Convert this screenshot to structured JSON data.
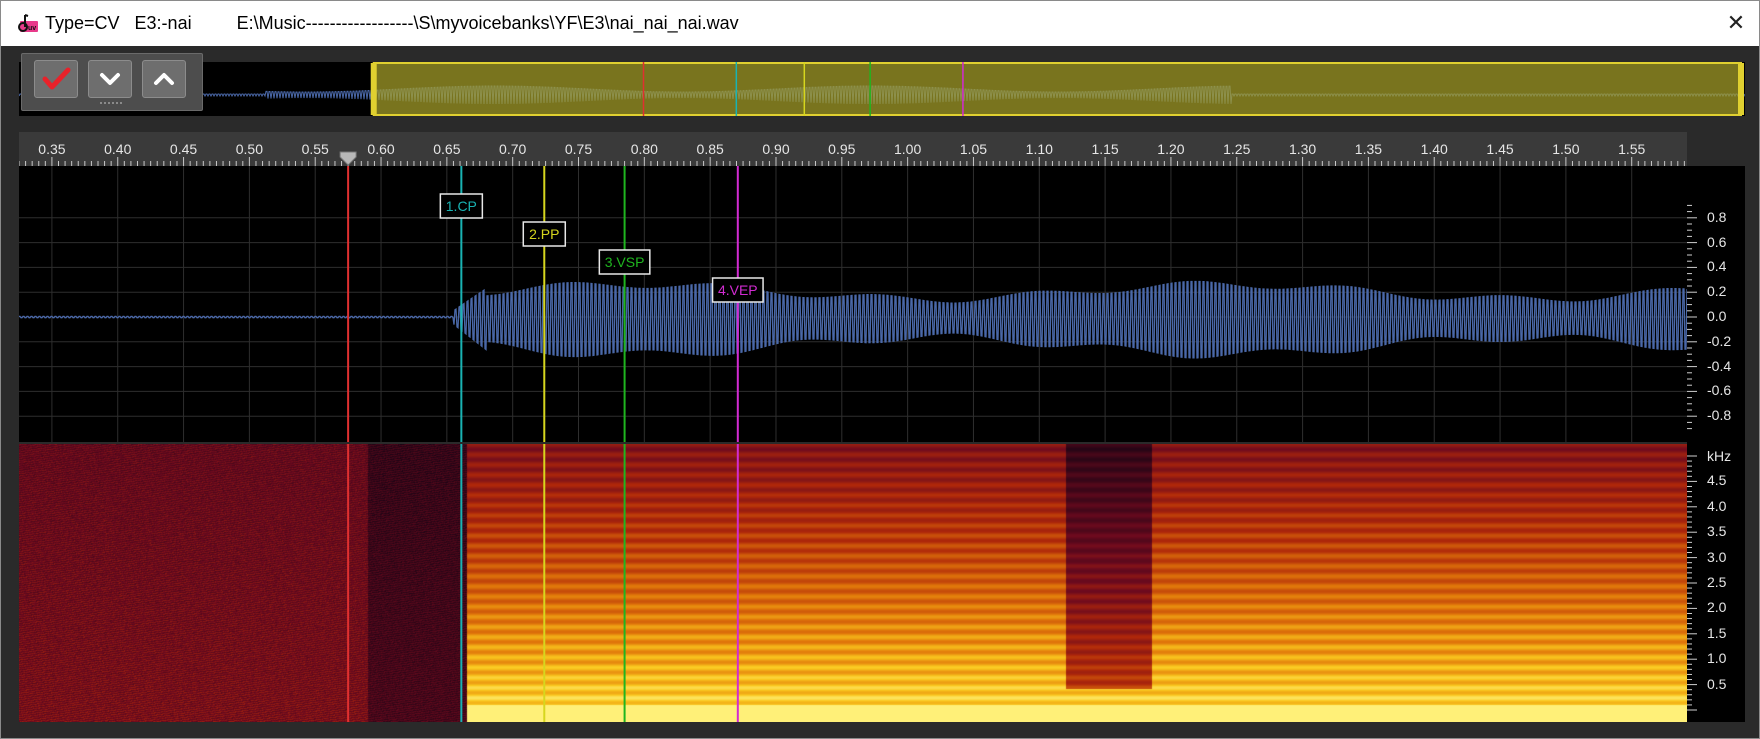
{
  "window": {
    "title": "Type=CV   E3:-nai         E:\\Music------------------\\S\\myvoicebanks\\YF\\E3\\nai_nai_nai.wav",
    "close_glyph": "✕",
    "app_icon": "oto-app-icon"
  },
  "toolbar": {
    "buttons": [
      {
        "name": "confirm-button",
        "icon": "check-icon"
      },
      {
        "name": "move-down-button",
        "icon": "chevron-down-icon"
      },
      {
        "name": "move-up-button",
        "icon": "chevron-up-icon"
      }
    ]
  },
  "time_axis": {
    "ticks": [
      "0.35",
      "0.40",
      "0.45",
      "0.50",
      "0.55",
      "0.60",
      "0.65",
      "0.70",
      "0.75",
      "0.80",
      "0.85",
      "0.90",
      "0.95",
      "1.00",
      "1.05",
      "1.10",
      "1.15",
      "1.20",
      "1.25",
      "1.30",
      "1.35",
      "1.40",
      "1.45",
      "1.50",
      "1.55"
    ],
    "tick_values": [
      0.35,
      0.4,
      0.45,
      0.5,
      0.55,
      0.6,
      0.65,
      0.7,
      0.75,
      0.8,
      0.85,
      0.9,
      0.95,
      1.0,
      1.05,
      1.1,
      1.15,
      1.2,
      1.25,
      1.3,
      1.35,
      1.4,
      1.45,
      1.5,
      1.55
    ],
    "range": [
      0.325,
      1.592
    ],
    "playhead": 0.575
  },
  "amplitude_axis": {
    "ticks": [
      "0.8",
      "0.6",
      "0.4",
      "0.2",
      "0.0",
      "-0.2",
      "-0.4",
      "-0.6",
      "-0.8"
    ],
    "values": [
      0.8,
      0.6,
      0.4,
      0.2,
      0.0,
      -0.2,
      -0.4,
      -0.6,
      -0.8
    ]
  },
  "frequency_axis": {
    "unit": "kHz",
    "ticks": [
      "4.5",
      "4.0",
      "3.5",
      "3.0",
      "2.5",
      "2.0",
      "1.5",
      "1.0",
      "0.5"
    ],
    "values": [
      4.5,
      4.0,
      3.5,
      3.0,
      2.5,
      2.0,
      1.5,
      1.0,
      0.5
    ]
  },
  "markers": [
    {
      "label": "",
      "name": "offset-line",
      "time": 0.575,
      "color": "#e03030"
    },
    {
      "label": "1.CP",
      "name": "marker-cp",
      "time": 0.661,
      "color": "#19b3b3"
    },
    {
      "label": "2.PP",
      "name": "marker-pp",
      "time": 0.724,
      "color": "#d6d61e"
    },
    {
      "label": "3.VSP",
      "name": "marker-vsp",
      "time": 0.785,
      "color": "#1fb51f"
    },
    {
      "label": "4.VEP",
      "name": "marker-vep",
      "time": 0.871,
      "color": "#d22bd2"
    }
  ],
  "colors": {
    "waveform": "#4a68a8",
    "overview_selection": "#a8a12a",
    "overview_selection_border": "#e0d030",
    "plot_background": "#000000",
    "grid": "#2e2e2e"
  }
}
